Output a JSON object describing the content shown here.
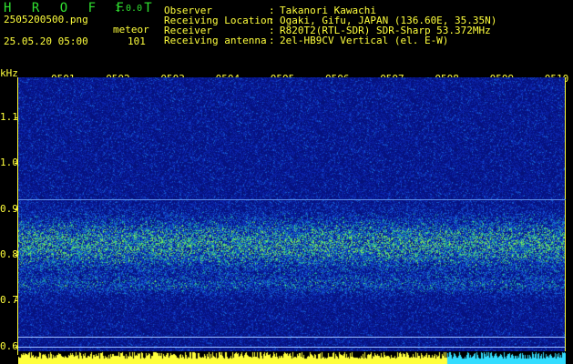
{
  "header": {
    "brand": "H R O F F T",
    "version": "1.0.0",
    "filename": "2505200500.png",
    "mode": "meteor",
    "datetime": "25.05.20 05:00",
    "count": "101",
    "observer_label": "Observer",
    "observer_value": "Takanori Kawachi",
    "location_label": "Receiving Location",
    "location_value": "Ogaki, Gifu, JAPAN (136.60E, 35.35N)",
    "receiver_label": "Receiver",
    "receiver_value": "R820T2(RTL-SDR) SDR-Sharp 53.372MHz",
    "antenna_label": "Receiving antenna",
    "antenna_value": "2el-HB9CV Vertical (el. E-W)",
    "separator": ":"
  },
  "axis": {
    "unit": "kHz",
    "time_labels": [
      "0501",
      "0502",
      "0503",
      "0504",
      "0505",
      "0506",
      "0507",
      "0508",
      "0509",
      "0510"
    ],
    "freq_labels": [
      "1.1",
      "1.0",
      "0.9",
      "0.8",
      "0.7",
      "0.6"
    ]
  },
  "colors": {
    "label": "#ffff3c",
    "background_noise": "#0a1f8c",
    "signal_band": "#2fbf40",
    "reference_line": "#7fb0ff",
    "bottom_bar_yellow": "#ffff3c",
    "bottom_bar_cyan": "#33ddff"
  }
}
